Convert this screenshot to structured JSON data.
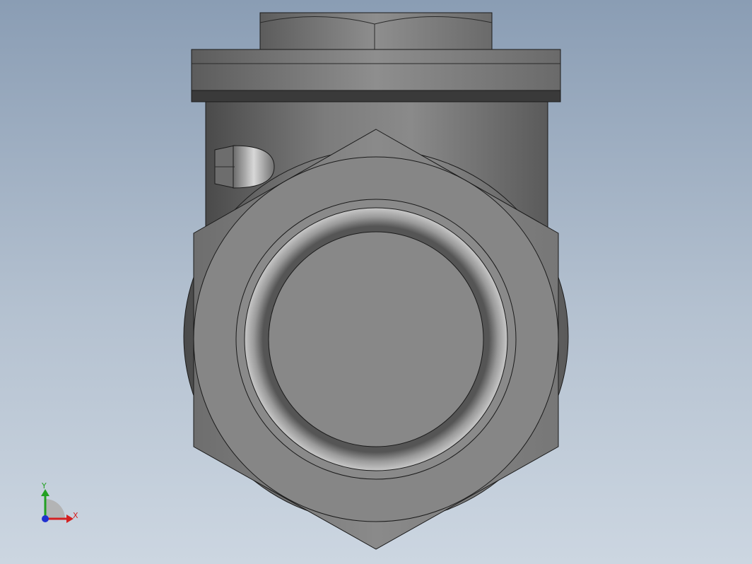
{
  "viewport": {
    "background_top": "#8a9db4",
    "background_bottom": "#ccd6e1"
  },
  "model": {
    "body_color": "#7a7a7a",
    "edge_color": "#1a1a1a"
  },
  "triad": {
    "x_label": "X",
    "y_label": "Y",
    "x_color": "#d42020",
    "y_color": "#22a022",
    "z_color": "#2030d0"
  }
}
